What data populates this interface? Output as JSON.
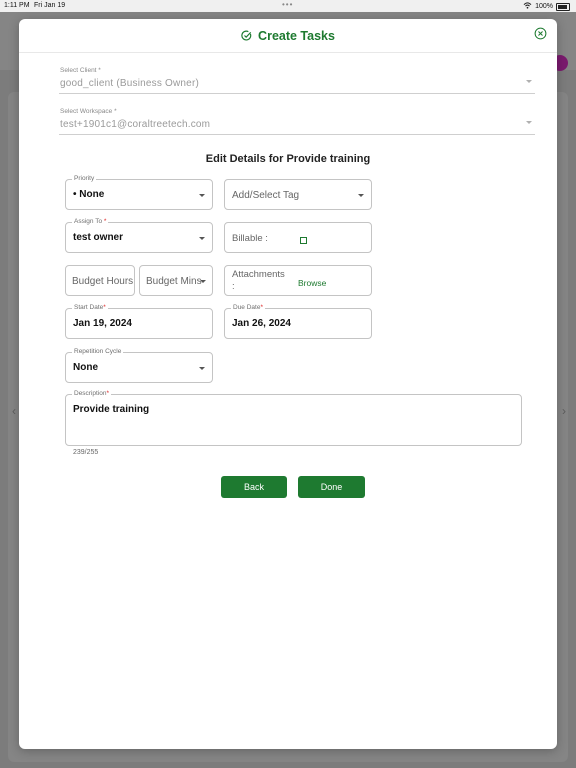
{
  "status": {
    "time": "1:11 PM",
    "date": "Fri Jan 19",
    "battery": "100%"
  },
  "modal": {
    "title": "Create Tasks",
    "client": {
      "label": "Select Client *",
      "value": "good_client (Business Owner)"
    },
    "workspace": {
      "label": "Select Workspace *",
      "value": "test+1901c1@coraltreetech.com"
    },
    "section_title": "Edit Details for Provide training",
    "priority": {
      "label": "Priority",
      "value": "• None"
    },
    "tag": {
      "placeholder": "Add/Select Tag"
    },
    "assign": {
      "label": "Assign To",
      "required": "*",
      "value": "test owner"
    },
    "billable": {
      "label": "Billable :"
    },
    "budget_hours": {
      "placeholder": "Budget Hours"
    },
    "budget_mins": {
      "placeholder": "Budget Mins"
    },
    "attachments": {
      "label_line1": "Attachments",
      "label_line2": ":",
      "browse": "Browse"
    },
    "start_date": {
      "label": "Start Date",
      "required": "*",
      "value": "Jan 19, 2024"
    },
    "due_date": {
      "label": "Due Date",
      "required": "*",
      "value": "Jan 26, 2024"
    },
    "repetition": {
      "label": "Repetition Cycle",
      "value": "None"
    },
    "description": {
      "label": "Description",
      "required": "*",
      "value": "Provide training",
      "counter": "239/255"
    },
    "buttons": {
      "back": "Back",
      "done": "Done"
    }
  },
  "colors": {
    "accent": "#1e7a30",
    "required": "#dd2222"
  }
}
